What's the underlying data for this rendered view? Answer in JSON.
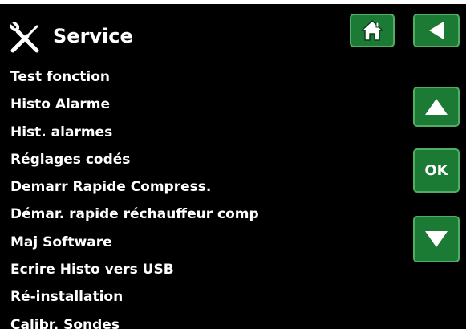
{
  "header": {
    "title": "Service",
    "icon": "wrench-screwdriver-icon"
  },
  "menu": {
    "items": [
      "Test fonction",
      "Histo Alarme",
      "Hist. alarmes",
      "Réglages codés",
      "Demarr Rapide Compress.",
      "Démar. rapide réchauffeur comp",
      "Maj Software",
      "Ecrire Histo vers USB",
      "Ré-installation",
      "Calibr. Sondes"
    ]
  },
  "controls": {
    "home_icon": "home-icon",
    "back_icon": "back-arrow-icon",
    "up_icon": "up-arrow-icon",
    "ok_label": "OK",
    "down_icon": "down-arrow-icon"
  },
  "colors": {
    "background": "#000000",
    "text": "#ffffff",
    "button_fill": "#1b7a34",
    "button_border": "#4fae62"
  }
}
